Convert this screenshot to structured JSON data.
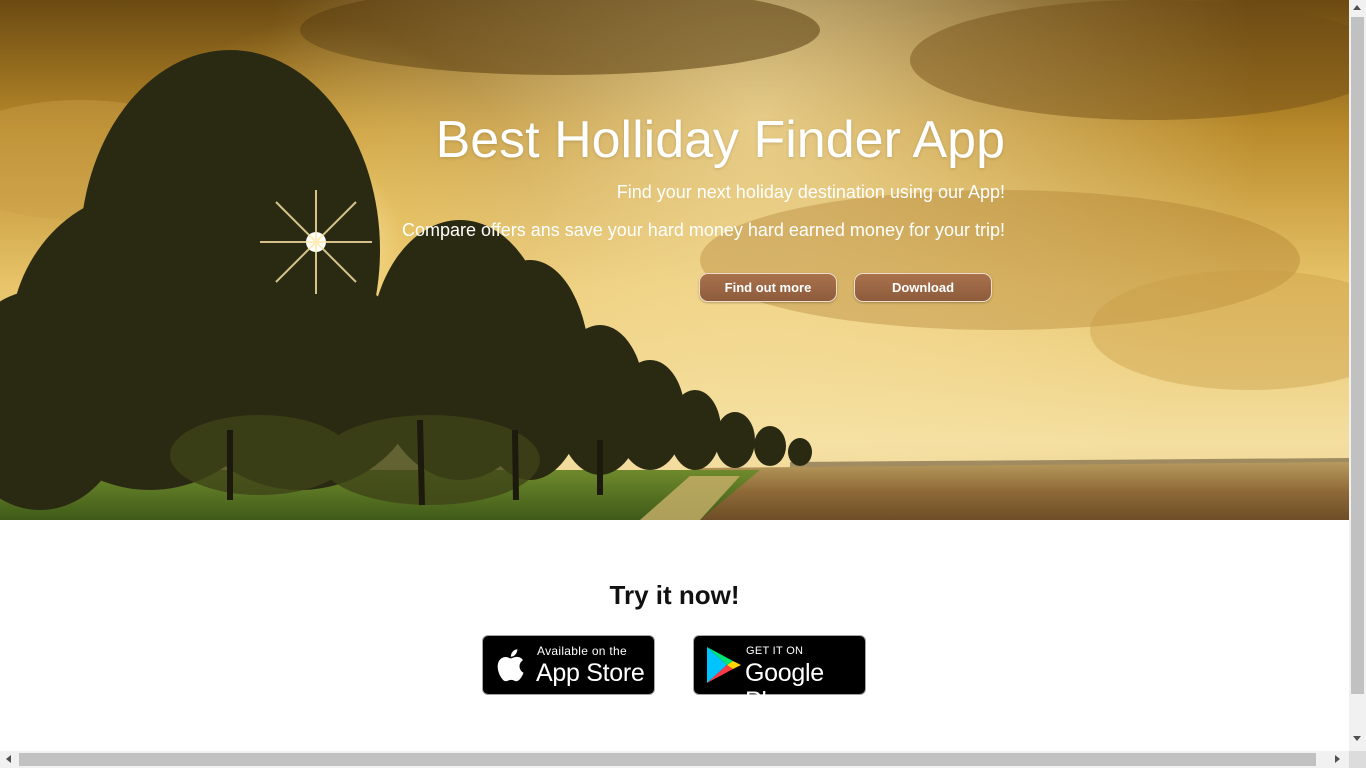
{
  "hero": {
    "title": "Best Holliday Finder App",
    "subtitle": "Find your next holiday destination using our App!",
    "subtitle2": "Compare offers ans save your hard money hard earned money for your trip!",
    "buttons": {
      "find_out_more": "Find out more",
      "download": "Download"
    },
    "background_icon": "sunset-field-trees-image"
  },
  "try": {
    "title": "Try it now!",
    "app_store": {
      "small": "Available on the",
      "big": "App Store",
      "icon": "apple-icon"
    },
    "google_play": {
      "small": "GET IT ON",
      "big": "Google Play",
      "icon": "google-play-icon"
    }
  },
  "colors": {
    "button_bg": "#9a6445",
    "button_border": "#f0dcc8",
    "badge_bg": "#000000",
    "page_bg": "#ffffff"
  }
}
